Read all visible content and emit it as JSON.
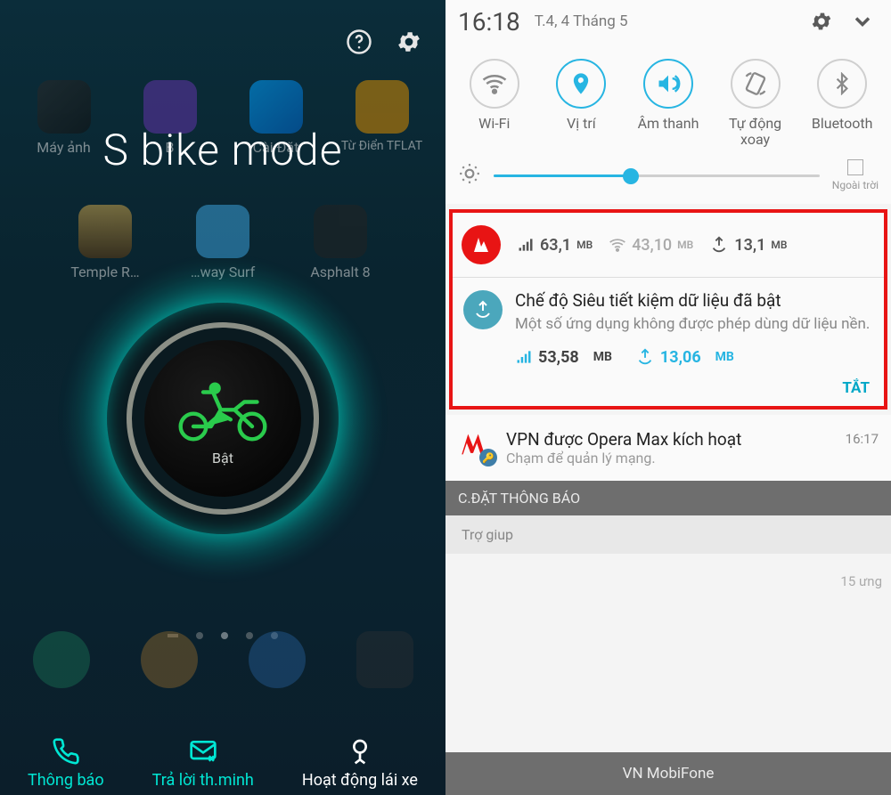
{
  "left": {
    "title": "S bike mode",
    "apps_row1": [
      "Máy ảnh",
      "B",
      "Cài Đặt",
      "Từ Điển TFLAT"
    ],
    "apps_row2": [
      "Temple R…",
      "…way Surf",
      "Asphalt 8"
    ],
    "button_label": "Bật",
    "tabs": [
      {
        "label": "Thông báo"
      },
      {
        "label": "Trả lời th.minh"
      },
      {
        "label": "Hoạt động lái xe"
      }
    ]
  },
  "right": {
    "time": "16:18",
    "date": "T.4, 4 Tháng 5",
    "toggles": [
      {
        "label": "Wi-Fi",
        "on": false
      },
      {
        "label": "Vị trí",
        "on": true
      },
      {
        "label": "Âm thanh",
        "on": true
      },
      {
        "label": "Tự động xoay",
        "on": false
      },
      {
        "label": "Bluetooth",
        "on": false
      }
    ],
    "brightness": {
      "auto_label": "Ngoài trời",
      "percent": 42
    },
    "data_stats": {
      "mobile": {
        "value": "63,1",
        "unit": "MB"
      },
      "wifi": {
        "value": "43,10",
        "unit": "MB"
      },
      "saved": {
        "value": "13,1",
        "unit": "MB"
      }
    },
    "opera_notif": {
      "title": "Chế độ Siêu tiết kiệm dữ liệu đã bật",
      "subtitle": "Một số ứng dụng không được phép dùng dữ liệu nền.",
      "mobile": {
        "value": "53,58",
        "unit": "MB"
      },
      "saved": {
        "value": "13,06",
        "unit": "MB"
      },
      "action": "TẮT"
    },
    "vpn": {
      "title": "VPN được Opera Max kích hoạt",
      "subtitle": "Chạm để quản lý mạng.",
      "time": "16:17"
    },
    "section_label": "C.ĐẶT THÔNG BÁO",
    "ghost_text": "15 ưng",
    "behind_text": "Trợ giup",
    "carrier": "VN MobiFone"
  }
}
